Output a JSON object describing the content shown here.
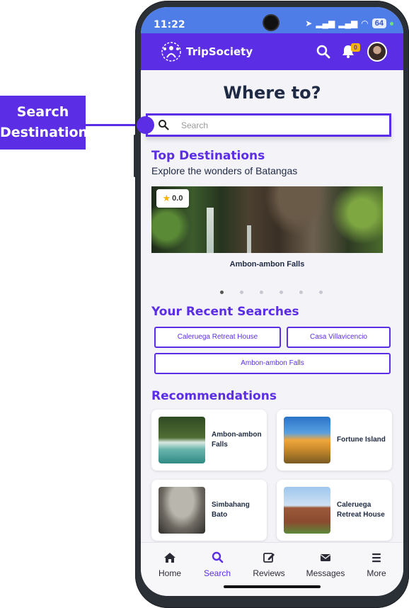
{
  "callout": {
    "line1": "Search",
    "line2": "Destination"
  },
  "status": {
    "time": "11:22",
    "battery": "64"
  },
  "header": {
    "brand": "TripSociety",
    "notification_count": "0"
  },
  "page_title": "Where to?",
  "search": {
    "placeholder": "Search"
  },
  "top_destinations": {
    "title": "Top Destinations",
    "subtitle": "Explore the wonders of Batangas",
    "featured": {
      "name": "Ambon-ambon Falls",
      "rating": "0.0"
    },
    "carousel_dots": 6
  },
  "recent_searches": {
    "title": "Your Recent Searches",
    "items": [
      "Caleruega Retreat House",
      "Casa Villavicencio",
      "Ambon-ambon Falls"
    ]
  },
  "recommendations": {
    "title": "Recommendations",
    "items": [
      {
        "name": "Ambon-ambon Falls"
      },
      {
        "name": "Fortune Island"
      },
      {
        "name": "Simbahang Bato"
      },
      {
        "name": "Caleruega Retreat House"
      }
    ]
  },
  "nav": {
    "items": [
      {
        "label": "Home",
        "icon": "home-icon"
      },
      {
        "label": "Search",
        "icon": "search-icon"
      },
      {
        "label": "Reviews",
        "icon": "edit-icon"
      },
      {
        "label": "Messages",
        "icon": "envelope-icon"
      },
      {
        "label": "More",
        "icon": "menu-icon"
      }
    ],
    "active": "Search"
  },
  "colors": {
    "brand": "#5b2ee6",
    "status_bar": "#4f7de8",
    "star": "#f5b400"
  }
}
